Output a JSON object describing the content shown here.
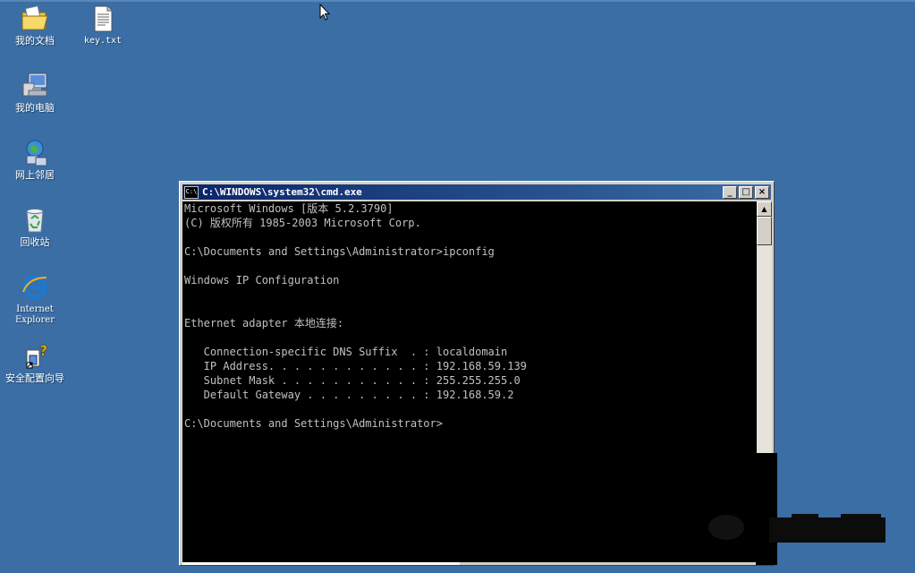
{
  "desktop": {
    "icons": [
      {
        "label": "我的文档",
        "icon": "folder-documents-icon"
      },
      {
        "label": "key.txt",
        "icon": "text-file-icon"
      },
      {
        "label": "我的电脑",
        "icon": "my-computer-icon"
      },
      {
        "label": "网上邻居",
        "icon": "network-places-icon"
      },
      {
        "label": "回收站",
        "icon": "recycle-bin-icon"
      },
      {
        "label": "Internet\nExplorer",
        "icon": "internet-explorer-icon"
      },
      {
        "label": "安全配置向导",
        "icon": "security-wizard-icon"
      }
    ],
    "background_color": "#3a6ea5"
  },
  "cmd_window": {
    "title": "C:\\WINDOWS\\system32\\cmd.exe",
    "sys_icon_text": "C:\\",
    "minimize_label": "_",
    "maximize_label": "□",
    "close_label": "×",
    "lines": [
      "Microsoft Windows [版本 5.2.3790]",
      "(C) 版权所有 1985-2003 Microsoft Corp.",
      "",
      "C:\\Documents and Settings\\Administrator>ipconfig",
      "",
      "Windows IP Configuration",
      "",
      "",
      "Ethernet adapter 本地连接:",
      "",
      "   Connection-specific DNS Suffix  . : localdomain",
      "   IP Address. . . . . . . . . . . . : 192.168.59.139",
      "   Subnet Mask . . . . . . . . . . . : 255.255.255.0",
      "   Default Gateway . . . . . . . . . : 192.168.59.2",
      "",
      "C:\\Documents and Settings\\Administrator>"
    ],
    "console_bg": "#000000",
    "console_fg": "#c0c0c0",
    "scroll_up_glyph": "▲"
  }
}
